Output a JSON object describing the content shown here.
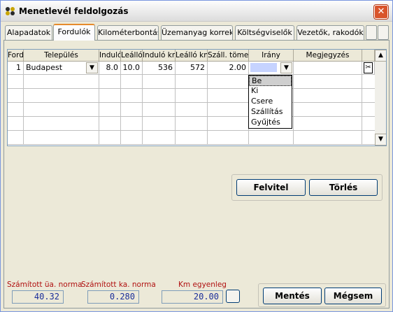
{
  "window": {
    "title": "Menetlevél feldolgozás"
  },
  "tabs": [
    "Alapadatok",
    "Fordulók",
    "Kilométerbontás",
    "Üzemanyag korrek.",
    "Költségviselők",
    "Vezetők, rakodók"
  ],
  "grid": {
    "columns": [
      "Ford",
      "Település",
      "Induló",
      "Leálló",
      "Induló km",
      "Leálló km",
      "Száll. tömeg",
      "Irány",
      "Megjegyzés"
    ],
    "rows": [
      [
        "1",
        "Budapest",
        "8.0",
        "10.0",
        "536",
        "572",
        "2.00",
        "",
        ""
      ]
    ]
  },
  "direction_dropdown": {
    "options": [
      "Be",
      "Ki",
      "Csere",
      "Szállítás",
      "Gyűjtés"
    ],
    "highlighted": "Be"
  },
  "buttons": {
    "record": "Felvitel",
    "delete": "Törlés",
    "save": "Mentés",
    "cancel": "Mégsem"
  },
  "stats": {
    "ua_norm_label": "Számított üa. norma",
    "ua_norm_value": "40.32",
    "ka_norm_label": "Számított ka. norma",
    "ka_norm_value": "0.280",
    "km_label": "Km egyenleg",
    "km_value": "20.00"
  },
  "icons": {
    "close": "close-icon",
    "app": "app-icon",
    "scissors": "scissors-icon"
  }
}
